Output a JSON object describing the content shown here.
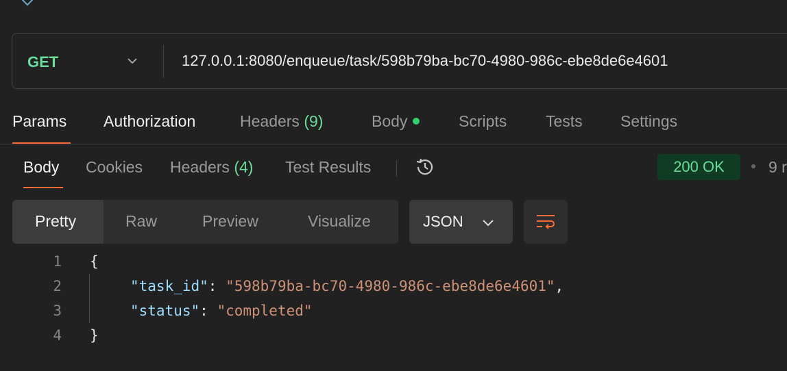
{
  "request": {
    "method": "GET",
    "url": "127.0.0.1:8080/enqueue/task/598b79ba-bc70-4980-986c-ebe8de6e4601"
  },
  "request_tabs": [
    {
      "label": "Params"
    },
    {
      "label": "Authorization"
    },
    {
      "label": "Headers",
      "count": "(9)"
    },
    {
      "label": "Body"
    },
    {
      "label": "Scripts"
    },
    {
      "label": "Tests"
    },
    {
      "label": "Settings"
    }
  ],
  "response_tabs": [
    {
      "label": "Body"
    },
    {
      "label": "Cookies"
    },
    {
      "label": "Headers",
      "count": "(4)"
    },
    {
      "label": "Test Results"
    }
  ],
  "status": "200 OK",
  "time_fragment": "9 r",
  "view_modes": [
    "Pretty",
    "Raw",
    "Preview",
    "Visualize"
  ],
  "format": "JSON",
  "code": {
    "line_numbers": [
      "1",
      "2",
      "3",
      "4"
    ],
    "open_brace": "{",
    "close_brace": "}",
    "key1": "\"task_id\"",
    "val1": "\"598b79ba-bc70-4980-986c-ebe8de6e4601\"",
    "key2": "\"status\"",
    "val2": "\"completed\"",
    "colon": ": ",
    "comma": ","
  },
  "colors": {
    "accent": "#ff6c37",
    "method_green": "#6bdd9a",
    "status_bg": "#0f3c22",
    "json_key": "#9cdcfe",
    "json_string": "#ce9178"
  }
}
